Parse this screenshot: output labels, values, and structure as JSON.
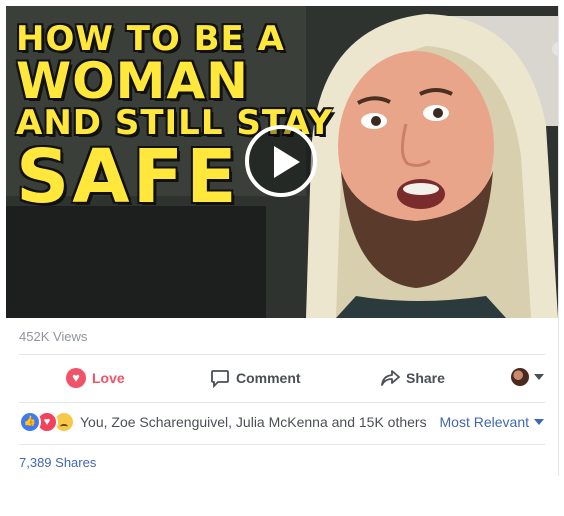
{
  "video": {
    "title_lines": [
      "HOW TO BE A",
      "WOMAN",
      "AND STILL STAY",
      "SAFE"
    ],
    "accent_color": "#ffe83b"
  },
  "stats": {
    "views": "452K Views",
    "shares": "7,389 Shares"
  },
  "actions": {
    "love": "Love",
    "comment": "Comment",
    "share": "Share"
  },
  "reactions": {
    "icons": [
      "like",
      "love",
      "sad"
    ],
    "summary": "You, Zoe Scharenguivel, Julia McKenna and 15K others",
    "sort_label": "Most Relevant"
  },
  "colors": {
    "love_red": "#f25268",
    "link_blue": "#4267b2",
    "muted_text": "#90949c"
  }
}
